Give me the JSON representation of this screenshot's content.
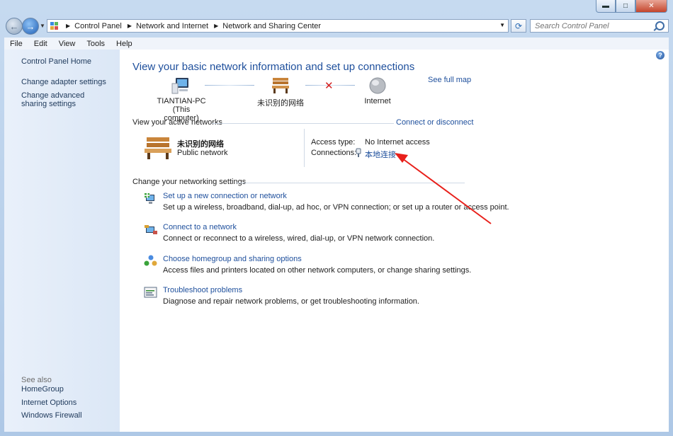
{
  "window": {
    "caption_minimize": "▬",
    "caption_maximize": "□",
    "caption_close": "✕"
  },
  "address_bar": {
    "breadcrumbs": [
      "Control Panel",
      "Network and Internet",
      "Network and Sharing Center"
    ],
    "icon": "control-panel-icon"
  },
  "search": {
    "placeholder": "Search Control Panel"
  },
  "menu": [
    "File",
    "Edit",
    "View",
    "Tools",
    "Help"
  ],
  "sidebar": {
    "home": "Control Panel Home",
    "links": [
      "Change adapter settings",
      "Change advanced sharing settings"
    ],
    "see_also_label": "See also",
    "see_also": [
      "HomeGroup",
      "Internet Options",
      "Windows Firewall"
    ]
  },
  "main": {
    "title": "View your basic network information and set up connections",
    "see_full_map": "See full map",
    "map": {
      "computer_name": "TIANTIAN-PC",
      "computer_sub": "(This computer)",
      "network_name": "未识别的网络",
      "internet": "Internet"
    },
    "active_networks_header": "View your active networks",
    "connect_disconnect": "Connect or disconnect",
    "network": {
      "name": "未识别的网络",
      "type": "Public network",
      "access_type_label": "Access type:",
      "access_type_value": "No Internet access",
      "connections_label": "Connections:",
      "connection_value": "本地连接"
    },
    "settings_header": "Change your networking settings",
    "tasks": [
      {
        "title": "Set up a new connection or network",
        "desc": "Set up a wireless, broadband, dial-up, ad hoc, or VPN connection; or set up a router or access point."
      },
      {
        "title": "Connect to a network",
        "desc": "Connect or reconnect to a wireless, wired, dial-up, or VPN network connection."
      },
      {
        "title": "Choose homegroup and sharing options",
        "desc": "Access files and printers located on other network computers, or change sharing settings."
      },
      {
        "title": "Troubleshoot problems",
        "desc": "Diagnose and repair network problems, or get troubleshooting information."
      }
    ]
  },
  "colors": {
    "link": "#1e4f9c",
    "annotation_arrow": "#e8201b",
    "disconnected_x": "#d21f1f"
  }
}
